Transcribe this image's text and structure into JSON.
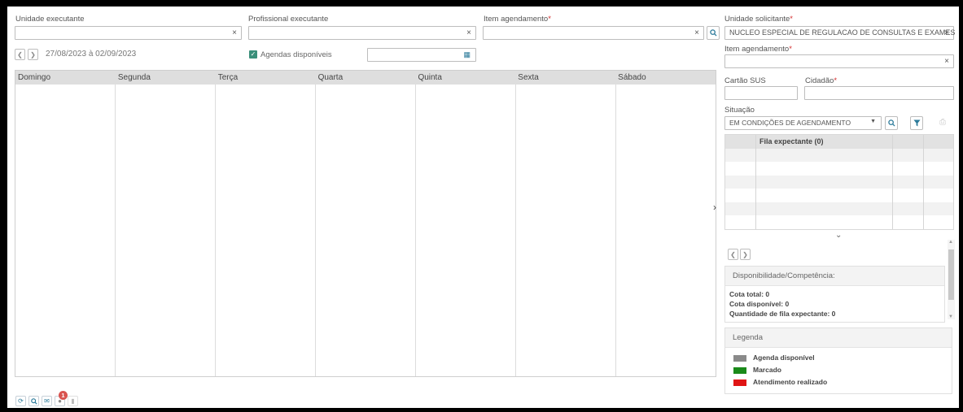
{
  "filters": {
    "unidade_executante_label": "Unidade executante",
    "profissional_executante_label": "Profissional executante",
    "item_agendamento_label": "Item agendamento",
    "required_mark": "*",
    "clear_icon": "×"
  },
  "toolbar": {
    "date_range": "27/08/2023 à 02/09/2023",
    "agendas_disponiveis_label": "Agendas disponíveis",
    "agendas_disponiveis_checked": true
  },
  "calendar": {
    "days": [
      "Domingo",
      "Segunda",
      "Terça",
      "Quarta",
      "Quinta",
      "Sexta",
      "Sábado"
    ]
  },
  "bottom_toolbar": {
    "badge_count": "1"
  },
  "right_panel": {
    "unidade_solicitante_label": "Unidade solicitante",
    "unidade_solicitante_value": "NUCLEO ESPECIAL DE REGULACAO DE CONSULTAS E EXAMES",
    "item_agendamento_label": "Item agendamento",
    "cartao_sus_label": "Cartão SUS",
    "cidadao_label": "Cidadão",
    "situacao_label": "Situação",
    "situacao_value": "EM CONDIÇÕES DE AGENDAMENTO",
    "fila_header": "Fila expectante (0)",
    "disponibilidade_title": "Disponibilidade/Competência:",
    "cota_total": "Cota total: 0",
    "cota_disponivel": "Cota disponível: 0",
    "quantidade_fila": "Quantidade de fila expectante: 0",
    "legenda_title": "Legenda",
    "legend": [
      {
        "label": "Agenda disponível",
        "color": "#8a8a8a"
      },
      {
        "label": "Marcado",
        "color": "#1a8a1a"
      },
      {
        "label": "Atendimento realizado",
        "color": "#e01515"
      }
    ]
  },
  "colors": {
    "accent": "#2b7a9a",
    "required": "#d32f2f",
    "badge": "#d9534f",
    "calendar_header": "#dedede"
  }
}
